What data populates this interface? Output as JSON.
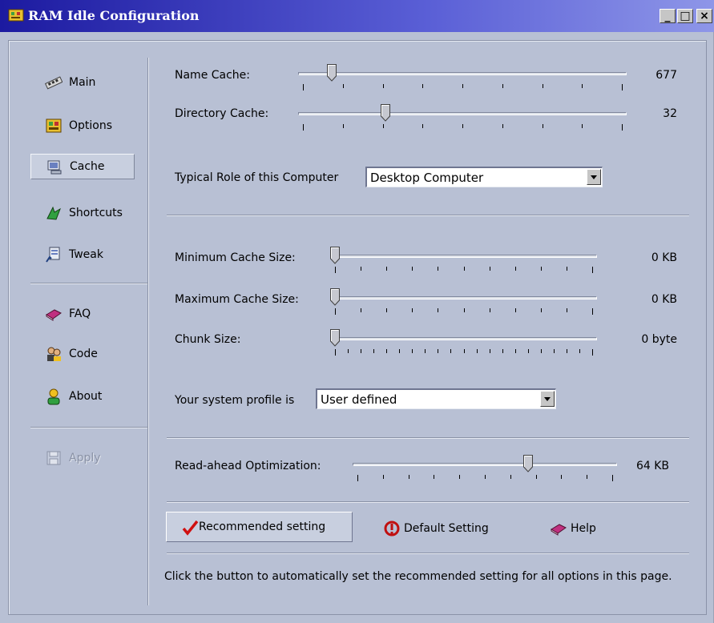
{
  "window": {
    "title": "RAM Idle Configuration",
    "minimize_label": "_",
    "maximize_label": "□",
    "close_label": "×"
  },
  "sidebar": {
    "items": [
      {
        "label": "Main",
        "icon": "ram-chip-icon"
      },
      {
        "label": "Options",
        "icon": "options-icon"
      },
      {
        "label": "Cache",
        "icon": "cache-icon",
        "selected": true
      },
      {
        "label": "Shortcuts",
        "icon": "shortcut-arrow-icon"
      },
      {
        "label": "Tweak",
        "icon": "tweak-icon"
      },
      {
        "label": "FAQ",
        "icon": "book-icon"
      },
      {
        "label": "Code",
        "icon": "people-icon"
      },
      {
        "label": "About",
        "icon": "person-icon"
      },
      {
        "label": "Apply",
        "icon": "disk-icon",
        "disabled": true
      }
    ]
  },
  "cache": {
    "name_cache": {
      "label": "Name Cache:",
      "value": "677",
      "position": 0.09
    },
    "directory_cache": {
      "label": "Directory Cache:",
      "value": "32",
      "position": 0.26
    },
    "role": {
      "label": "Typical Role of this Computer",
      "selected": "Desktop Computer"
    },
    "min_cache": {
      "label": "Minimum Cache Size:",
      "value": "0 KB",
      "position": 0
    },
    "max_cache": {
      "label": "Maximum Cache Size:",
      "value": "0 KB",
      "position": 0
    },
    "chunk_size": {
      "label": "Chunk Size:",
      "value": "0 byte",
      "position": 0
    },
    "profile": {
      "label": "Your system profile is",
      "selected": "User defined"
    },
    "read_ahead": {
      "label": "Read-ahead Optimization:",
      "value": "64 KB",
      "position": 0.67
    }
  },
  "buttons": {
    "recommended": "Recommended setting",
    "default": "Default Setting",
    "help": "Help"
  },
  "help_text": "Click the button to automatically set the recommended setting for all options in this page.",
  "colors": {
    "title_start": "#1c1aa0",
    "title_end": "#8e96e8",
    "panel": "#b8c0d4",
    "check": "#d01010"
  }
}
